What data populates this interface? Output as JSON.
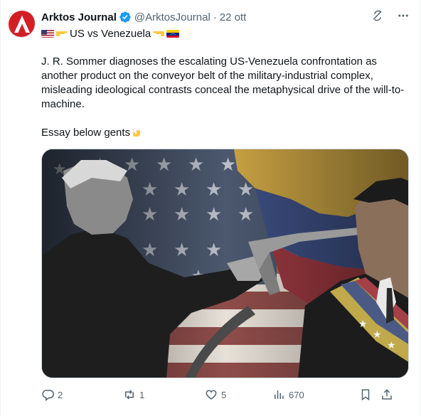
{
  "post": {
    "author_name": "Arktos Journal",
    "handle": "@ArktosJournal",
    "separator": "·",
    "date": "22 ott",
    "subtitle_text": "US vs Venezuela",
    "paragraph1": "J. R. Sommer diagnoses the escalating US-Venezuela confrontation as another product on the conveyor belt of the military-industrial complex, misleading ideological contrasts conceal the metaphysical drive of the will-to-machine.",
    "paragraph2": "Essay below gents",
    "verified_color": "#1d9bf0",
    "accent_color": "#d21f26"
  },
  "actions": {
    "replies": "2",
    "reposts": "1",
    "likes": "5",
    "views": "670"
  },
  "icons": [
    "grok-icon",
    "more-icon",
    "reply-icon",
    "repost-icon",
    "like-icon",
    "views-icon",
    "bookmark-icon",
    "share-icon",
    "verified-badge-icon",
    "pointing-down-emoji",
    "pointing-left-emoji",
    "pointing-right-emoji",
    "us-flag",
    "venezuela-flag"
  ]
}
